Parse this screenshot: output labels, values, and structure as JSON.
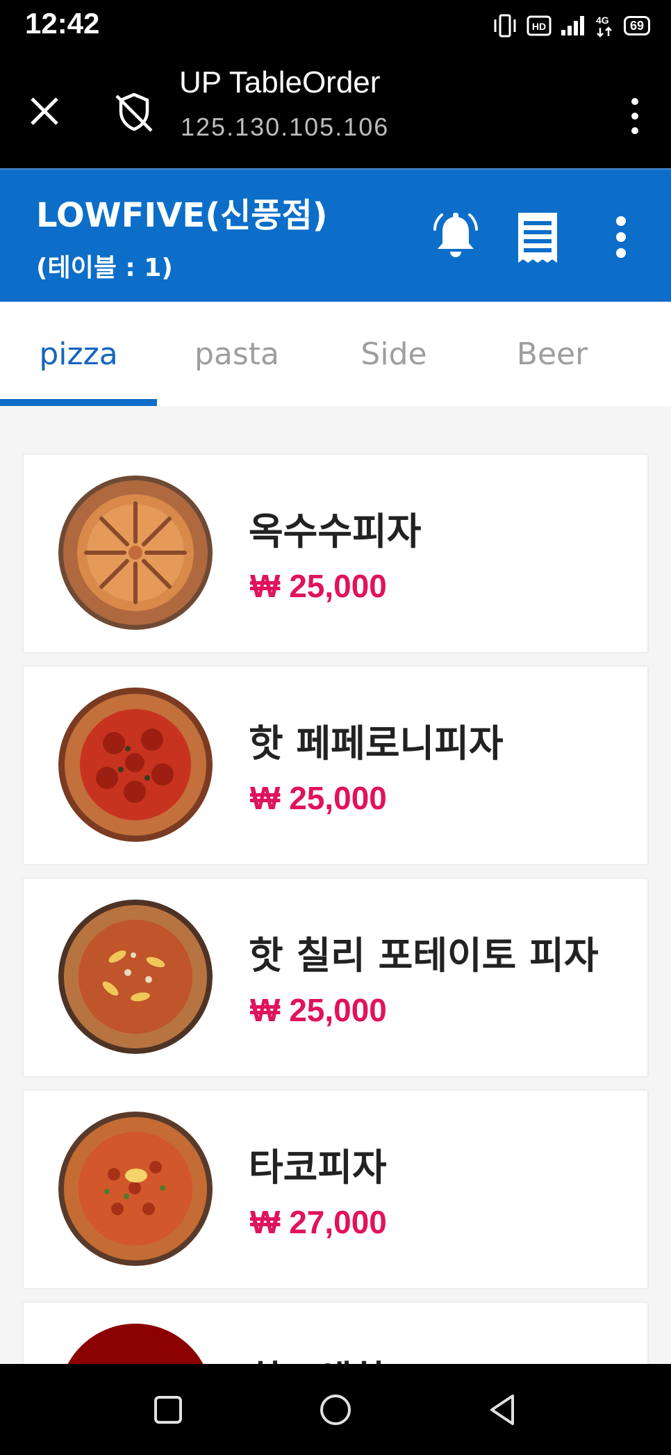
{
  "status_bar": {
    "time": "12:42",
    "network": "HD",
    "signal_type": "4G",
    "battery": "69"
  },
  "browser": {
    "title": "UP TableOrder",
    "url": "125.130.105.106"
  },
  "header": {
    "store_name": "LOWFIVE(신풍점)",
    "table_info": "(테이블 : 1)",
    "accent_color": "#0c6ec9"
  },
  "tabs": [
    {
      "label": "pizza",
      "active": true
    },
    {
      "label": "pasta",
      "active": false
    },
    {
      "label": "Side",
      "active": false
    },
    {
      "label": "Beer",
      "active": false
    }
  ],
  "menu_items": [
    {
      "name": "옥수수피자",
      "price": "₩ 25,000"
    },
    {
      "name": "핫 페페로니피자",
      "price": "₩ 25,000"
    },
    {
      "name": "핫 칠리 포테이토 피자",
      "price": "₩ 25,000"
    },
    {
      "name": "타코피자",
      "price": "₩ 27,000"
    },
    {
      "name": "하프앤하프",
      "price": ""
    }
  ],
  "price_color": "#e0135d"
}
